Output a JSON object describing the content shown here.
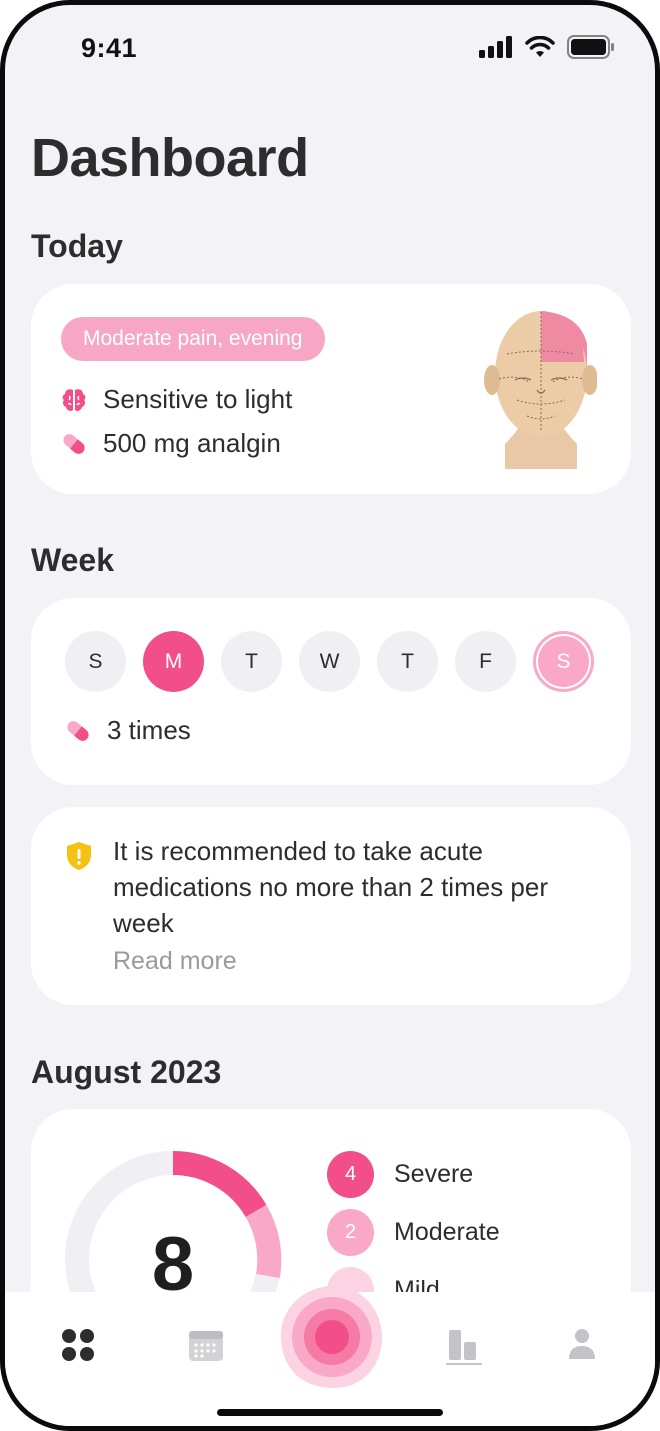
{
  "status_bar": {
    "time": "9:41"
  },
  "page_title": "Dashboard",
  "today": {
    "section_title": "Today",
    "pain_badge": "Moderate pain, evening",
    "symptom": "Sensitive to light",
    "medication": "500 mg analgin",
    "head_illustration": "head-map-illustration"
  },
  "week": {
    "section_title": "Week",
    "days": [
      "S",
      "M",
      "T",
      "W",
      "T",
      "F",
      "S"
    ],
    "selected_day_index": 1,
    "today_index": 6,
    "medication_count": "3 times"
  },
  "advice": {
    "text": "It is recommended to take acute medications no more than 2 times per week",
    "read_more": "Read more",
    "icon": "shield-warning-icon"
  },
  "month": {
    "section_title": "August 2023",
    "total": "8",
    "legend": [
      {
        "count": "4",
        "label": "Severe",
        "color": "#f24e8a"
      },
      {
        "count": "2",
        "label": "Moderate",
        "color": "#f9a8c7"
      },
      {
        "count": "",
        "label": "Mild",
        "color": "#fcd3e2"
      }
    ]
  },
  "tabbar": {
    "tabs": [
      "dashboard-icon",
      "calendar-icon",
      "record-pain-button",
      "statistics-icon",
      "profile-icon"
    ],
    "accent": "#f24e8a"
  }
}
